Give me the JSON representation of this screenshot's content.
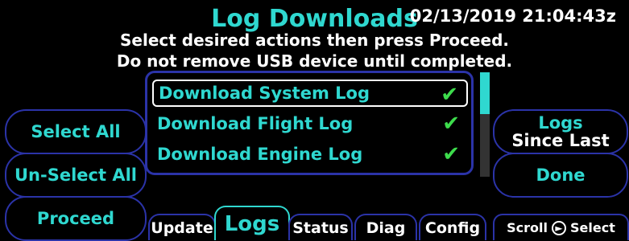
{
  "header": {
    "title": "Log Downloads",
    "timestamp": "02/13/2019 21:04:43z",
    "instruction_line1": "Select desired actions then press Proceed.",
    "instruction_line2": "Do not remove USB device until completed."
  },
  "left_buttons": {
    "select_all": "Select All",
    "unselect_all": "Un-Select All",
    "proceed": "Proceed"
  },
  "right_buttons": {
    "logs_line1": "Logs",
    "logs_line2": "Since Last",
    "done": "Done"
  },
  "log_list": {
    "items": [
      {
        "label": "Download System Log",
        "checked": true,
        "selected": true
      },
      {
        "label": "Download Flight Log",
        "checked": true,
        "selected": false
      },
      {
        "label": "Download Engine Log",
        "checked": true,
        "selected": false
      }
    ],
    "check_symbol": "✔"
  },
  "scrollbar": {
    "position_fraction": 0.0,
    "visible_fraction": 0.4
  },
  "tabs": [
    {
      "label": "Update",
      "active": false
    },
    {
      "label": "Logs",
      "active": true
    },
    {
      "label": "Status",
      "active": false
    },
    {
      "label": "Diag",
      "active": false
    },
    {
      "label": "Config",
      "active": false
    }
  ],
  "legend": {
    "scroll_label": "Scroll",
    "select_label": "Select",
    "icon": "rotary-knob-icon"
  },
  "colors": {
    "accent": "#2fd8d0",
    "border": "#2b33a8",
    "check": "#3ddc4c",
    "text": "#ffffff"
  }
}
